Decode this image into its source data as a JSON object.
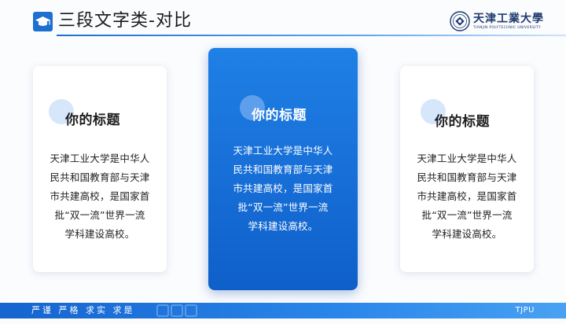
{
  "header": {
    "title": "三段文字类-对比",
    "logo_icon": "graduation-cap-icon",
    "university_name": "天津工業大學",
    "university_sub": "TIANJIN POLYTECHNIC UNIVERSITY"
  },
  "cards": [
    {
      "title": "你的标题",
      "lines": [
        "天津工业大学是中华人",
        "民共和国教育部与天津",
        "市共建高校，是国家首",
        "批“双一流”世界一流",
        "学科建设高校。"
      ]
    },
    {
      "title": "你的标题",
      "lines": [
        "天津工业大学是中华人",
        "民共和国教育部与天津",
        "市共建高校，是国家首",
        "批“双一流”世界一流",
        "学科建设高校。"
      ]
    },
    {
      "title": "你的标题",
      "lines": [
        "天津工业大学是中华人",
        "民共和国教育部与天津",
        "市共建高校，是国家首",
        "批“双一流”世界一流",
        "学科建设高校。"
      ]
    }
  ],
  "footer": {
    "motto": "严谨 严格 求实 求是",
    "tag": "TJPU"
  },
  "colors": {
    "accent": "#1d6fd0",
    "highlight_card": "#1f80e6",
    "footer": "#1564cf"
  }
}
